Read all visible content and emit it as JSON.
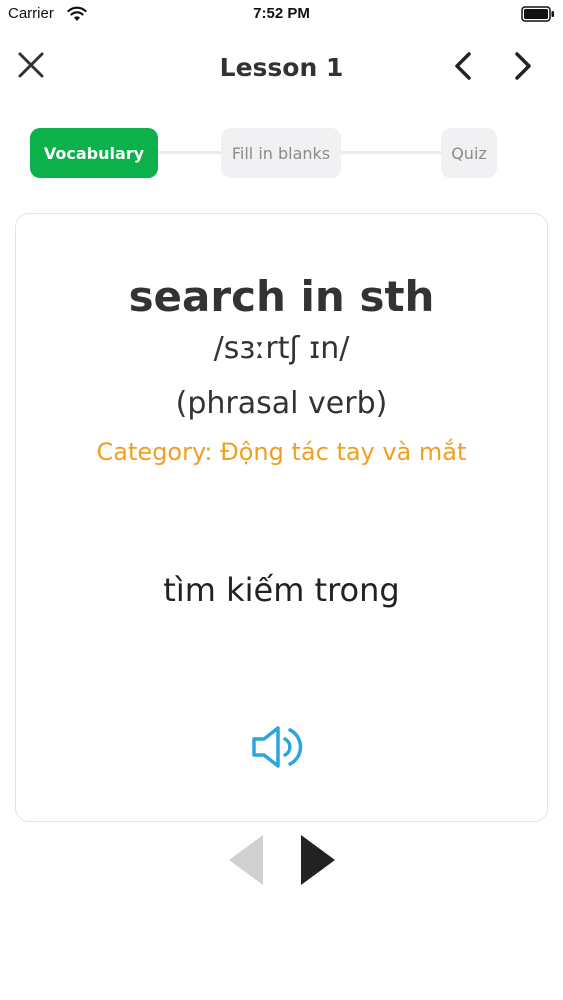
{
  "status_bar": {
    "carrier": "Carrier",
    "time": "7:52 PM",
    "icons": [
      "wifi-icon",
      "battery-icon"
    ]
  },
  "nav": {
    "title": "Lesson 1",
    "icons": [
      "close-icon",
      "chevron-left-icon",
      "chevron-right-icon"
    ]
  },
  "steps": [
    {
      "label": "Vocabulary",
      "active": true
    },
    {
      "label": "Fill in blanks",
      "active": false
    },
    {
      "label": "Quiz",
      "active": false
    }
  ],
  "card": {
    "word": "search in sth",
    "phonetic": "/sɜːrtʃ ɪn/",
    "part_of_speech": "(phrasal verb)",
    "category": "Category: Động tác tay và mắt",
    "meaning": "tìm kiếm trong",
    "audio_icon": "speaker-icon"
  },
  "pager": {
    "prev_icon": "triangle-left-icon",
    "next_icon": "triangle-right-icon",
    "prev_enabled": false,
    "next_enabled": true
  },
  "colors": {
    "accent": "#0db14b",
    "category": "#f0a020",
    "audio": "#2aa6dc",
    "disabled": "#d0d0d0"
  }
}
